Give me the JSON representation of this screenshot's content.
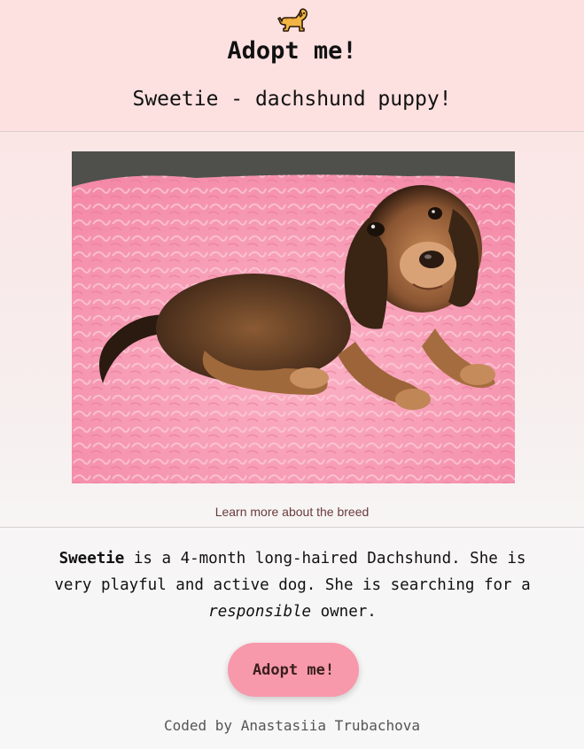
{
  "header": {
    "icon": "dog-icon",
    "title": "Adopt me!",
    "subtitle": "Sweetie - dachshund puppy!"
  },
  "photo": {
    "alt": "dachshund-puppy-photo"
  },
  "link": {
    "label": "Learn more about the breed"
  },
  "description": {
    "name": "Sweetie",
    "text_1": " is a 4-month long-haired Dachshund. She is very playful and active dog. She is searching for a ",
    "emphasis": "responsible",
    "text_2": " owner."
  },
  "button": {
    "label": "Adopt me!"
  },
  "footer": {
    "text": "Coded by Anastasiia Trubachova"
  },
  "colors": {
    "header_bg": "#fde0e0",
    "button_bg": "#f799ab",
    "link": "#6b3b3b"
  }
}
